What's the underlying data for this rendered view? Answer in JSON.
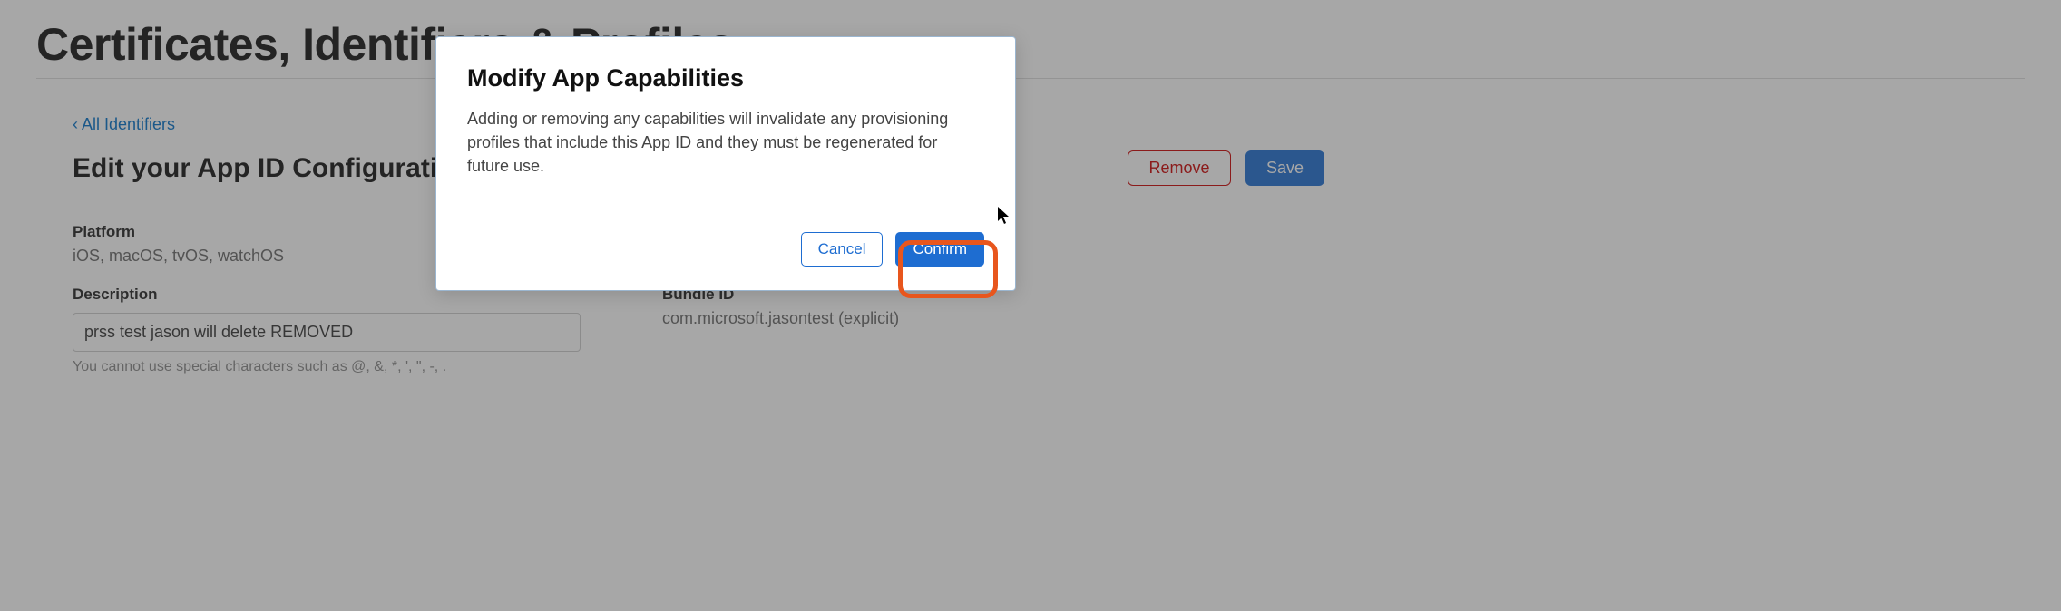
{
  "page": {
    "title": "Certificates, Identifiers & Profiles"
  },
  "nav": {
    "back_link": "‹ All Identifiers"
  },
  "section": {
    "title": "Edit your App ID Configuration",
    "remove_label": "Remove",
    "save_label": "Save"
  },
  "platform": {
    "label": "Platform",
    "value": "iOS, macOS, tvOS, watchOS"
  },
  "description": {
    "label": "Description",
    "value": "prss test jason will delete REMOVED",
    "hint": "You cannot use special characters such as @, &, *, ', \", -, ."
  },
  "bundle": {
    "label": "Bundle ID",
    "value": "com.microsoft.jasontest (explicit)"
  },
  "modal": {
    "title": "Modify App Capabilities",
    "body": "Adding or removing any capabilities will invalidate any provisioning profiles that include this App ID and they must be regenerated for future use.",
    "cancel_label": "Cancel",
    "confirm_label": "Confirm"
  }
}
